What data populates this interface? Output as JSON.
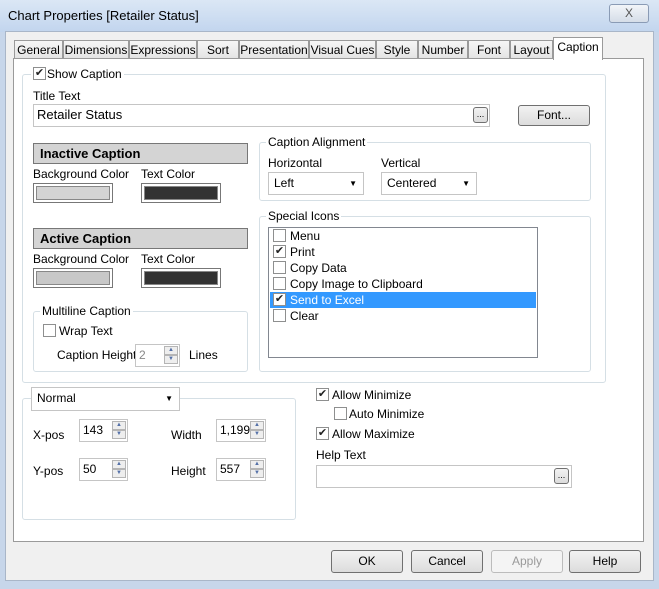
{
  "window": {
    "title": "Chart Properties [Retailer Status]",
    "close": "X"
  },
  "tabs": [
    "General",
    "Dimensions",
    "Expressions",
    "Sort",
    "Presentation",
    "Visual Cues",
    "Style",
    "Number",
    "Font",
    "Layout",
    "Caption"
  ],
  "active_tab": "Caption",
  "caption": {
    "show_caption": {
      "label": "Show Caption",
      "checked": true
    },
    "title_text_label": "Title Text",
    "title_text_value": "Retailer Status",
    "ellipsis": "...",
    "font_button": "Font...",
    "inactive": {
      "header": "Inactive Caption",
      "bg_label": "Background Color",
      "text_label": "Text Color",
      "bg_color": "#d4d4d4",
      "text_color": "#333333"
    },
    "active": {
      "header": "Active Caption",
      "bg_label": "Background Color",
      "text_label": "Text Color",
      "bg_color": "#c8c8c8",
      "text_color": "#333333"
    },
    "multiline": {
      "label": "Multiline Caption",
      "wrap_text": "Wrap Text",
      "wrap_checked": false,
      "height_label": "Caption Height",
      "height_value": "2",
      "lines_label": "Lines"
    },
    "alignment": {
      "label": "Caption Alignment",
      "horizontal_label": "Horizontal",
      "horizontal_value": "Left",
      "vertical_label": "Vertical",
      "vertical_value": "Centered"
    },
    "special_icons": {
      "label": "Special Icons",
      "items": [
        {
          "label": "Menu",
          "checked": false
        },
        {
          "label": "Print",
          "checked": true
        },
        {
          "label": "Copy Data",
          "checked": false
        },
        {
          "label": "Copy Image to Clipboard",
          "checked": false
        },
        {
          "label": "Send to Excel",
          "checked": true,
          "selected": true
        },
        {
          "label": "Clear",
          "checked": false
        }
      ]
    }
  },
  "position": {
    "mode": "Normal",
    "xpos_label": "X-pos",
    "xpos": "143",
    "ypos_label": "Y-pos",
    "ypos": "50",
    "width_label": "Width",
    "width": "1,199",
    "height_label": "Height",
    "height": "557"
  },
  "options": {
    "allow_minimize": "Allow Minimize",
    "auto_minimize": "Auto Minimize",
    "allow_maximize": "Allow Maximize",
    "help_text_label": "Help Text",
    "help_text_value": ""
  },
  "buttons": {
    "ok": "OK",
    "cancel": "Cancel",
    "apply": "Apply",
    "help": "Help"
  },
  "colors": {
    "selection": "#3399ff"
  }
}
